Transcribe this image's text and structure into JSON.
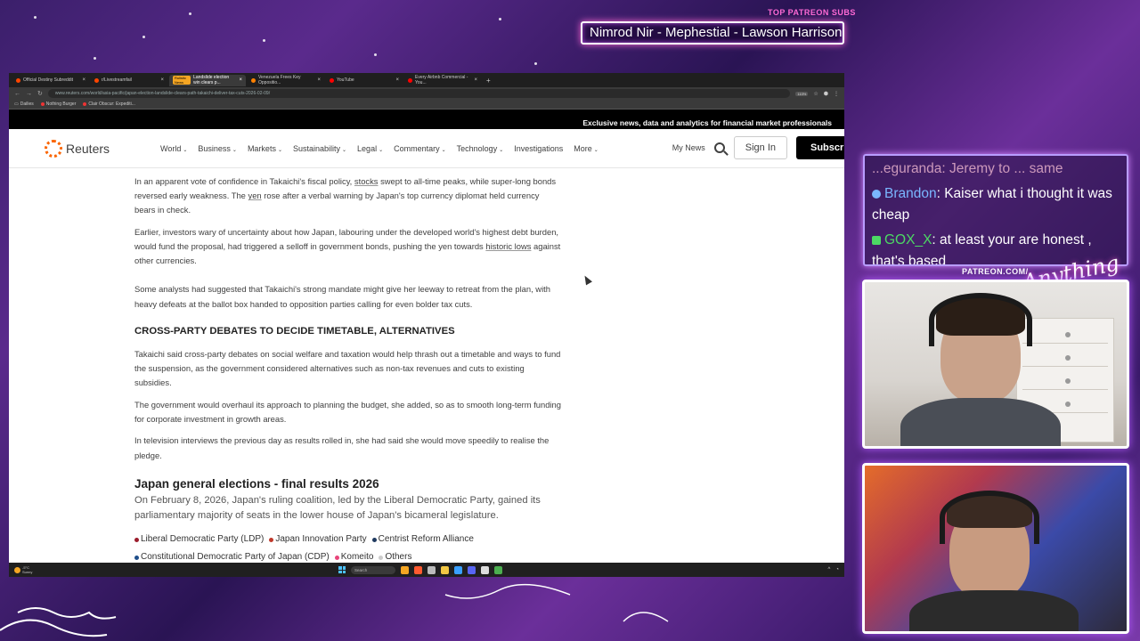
{
  "stream_overlay": {
    "patreon_subs_label": "TOP PATREON SUBS",
    "ticker_text": "Nimrod Nir - Mephestial - Lawson Harrison",
    "patreon_url": "PATREON.COM/",
    "script_logo": "Anything Else?"
  },
  "browser": {
    "tabs": [
      {
        "label": "Official Destiny Subreddit",
        "icon": "reddit-icon",
        "active": false
      },
      {
        "label": "r/Livestreamfail",
        "icon": "reddit-icon",
        "active": false
      },
      {
        "label": "Landslide election win clears p...",
        "chip": "Rulistic News",
        "icon": "reuters-icon",
        "active": true
      },
      {
        "label": "Venezuela Frees Key Oppositio...",
        "icon": "news-icon",
        "active": false
      },
      {
        "label": "YouTube",
        "icon": "youtube-icon",
        "active": false
      },
      {
        "label": "Every Airbnb Commercial - You...",
        "icon": "youtube-icon",
        "active": false
      }
    ],
    "url": "www.reuters.com/world/asia-pacific/japan-election-landslide-clears-path-takaichi-deliver-tax-cuts-2026-02-09/",
    "zoom": "110%",
    "bookmarks": [
      "Dailies",
      "Nothing Burger",
      "Clair Obscur: Expediti..."
    ]
  },
  "reuters": {
    "promo": "Exclusive news, data and analytics for financial market professionals",
    "logo": "Reuters",
    "nav": [
      "World",
      "Business",
      "Markets",
      "Sustainability",
      "Legal",
      "Commentary",
      "Technology",
      "Investigations",
      "More"
    ],
    "nav_has_chevron": [
      true,
      true,
      true,
      true,
      true,
      true,
      true,
      false,
      true
    ],
    "my_news": "My News",
    "sign_in": "Sign In",
    "subscribe": "Subscribe"
  },
  "article": {
    "p1_a": "In an apparent vote of confidence in Takaichi's fiscal policy, ",
    "p1_link1": "stocks",
    "p1_b": " swept to all-time peaks, while super-long bonds reversed early weakness. The ",
    "p1_link2": "yen",
    "p1_c": " rose after a verbal warning by Japan's top currency diplomat held currency bears in check.",
    "p2_a": "Earlier, investors wary of uncertainty about how Japan, labouring under the developed world's highest debt burden, would fund the proposal, had triggered a selloff in government bonds, pushing the yen towards ",
    "p2_link": "historic lows",
    "p2_b": " against other currencies.",
    "p3": "Some analysts had suggested that Takaichi's strong mandate might give her leeway to retreat from the plan, with heavy defeats at the ballot box handed to opposition parties calling for even bolder tax cuts.",
    "subheading": "CROSS-PARTY DEBATES TO DECIDE TIMETABLE, ALTERNATIVES",
    "p4": "Takaichi said cross-party debates on social welfare and taxation would help thrash out a timetable and ways to fund the suspension, as the government considered alternatives such as non-tax revenues and cuts to existing subsidies.",
    "p5": "The government would overhaul its approach to planning the budget, she added, so as to smooth long-term funding for corporate investment in growth areas.",
    "p6": "In television interviews the previous day as results rolled in, she had said she would move speedily to realise the pledge.",
    "results_title": "Japan general elections - final results 2026",
    "results_lead": "On February 8, 2026, Japan's ruling coalition, led by the Liberal Democratic Party, gained its parliamentary majority of seats in the lower house of Japan's bicameral legislature.",
    "legend": [
      {
        "label": "Liberal Democratic Party (LDP)",
        "color": "#9b1c2c"
      },
      {
        "label": "Japan Innovation Party",
        "color": "#c0392b"
      },
      {
        "label": "Centrist Reform Alliance",
        "color": "#1f3a5f"
      },
      {
        "label": "Constitutional Democratic Party of Japan (CDP)",
        "color": "#1f4e8a"
      },
      {
        "label": "Komeito",
        "color": "#e8457a"
      },
      {
        "label": "Others",
        "color": "#cccccc"
      }
    ]
  },
  "taskbar": {
    "weather_temp": "-5°C",
    "weather_desc": "Sunny",
    "search_label": "Search"
  },
  "chat": {
    "truncated_line": "...eguranda: Jeremy to ... same",
    "messages": [
      {
        "user": "Brandon",
        "text": ": Kaiser what i thought it was cheap",
        "color": "#7ab7ff"
      },
      {
        "user": "GOX_X",
        "text": ": at least your are honest , that's based",
        "color": "#4cd964"
      }
    ]
  }
}
